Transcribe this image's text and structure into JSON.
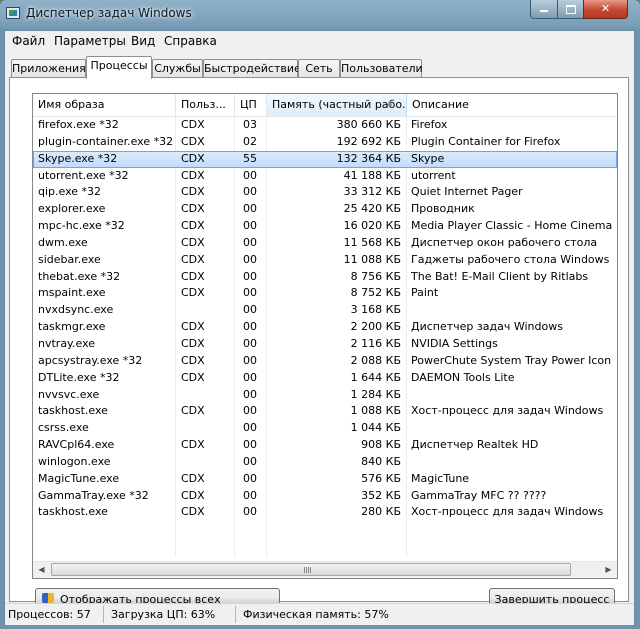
{
  "window": {
    "title": "Диспетчер задач Windows",
    "controls": [
      "minimize-icon",
      "maximize-icon",
      "close-icon"
    ]
  },
  "menu": [
    "Файл",
    "Параметры",
    "Вид",
    "Справка"
  ],
  "tabs": [
    {
      "label": "Приложения",
      "active": false
    },
    {
      "label": "Процессы",
      "active": true
    },
    {
      "label": "Службы",
      "active": false
    },
    {
      "label": "Быстродействие",
      "active": false
    },
    {
      "label": "Сеть",
      "active": false
    },
    {
      "label": "Пользователи",
      "active": false
    }
  ],
  "columns": [
    {
      "label": "Имя образа"
    },
    {
      "label": "Польз..."
    },
    {
      "label": "ЦП"
    },
    {
      "label": "Память (частный рабо...",
      "sorted": true
    },
    {
      "label": "Описание"
    }
  ],
  "processes": [
    {
      "name": "firefox.exe *32",
      "user": "CDX",
      "cpu": "03",
      "memory": "380 660 КБ",
      "description": "Firefox"
    },
    {
      "name": "plugin-container.exe *32",
      "user": "CDX",
      "cpu": "02",
      "memory": "192 692 КБ",
      "description": "Plugin Container for Firefox"
    },
    {
      "name": "Skype.exe *32",
      "user": "CDX",
      "cpu": "55",
      "memory": "132 364 КБ",
      "description": "Skype",
      "selected": true
    },
    {
      "name": "utorrent.exe *32",
      "user": "CDX",
      "cpu": "00",
      "memory": "41 188 КБ",
      "description": "utorrent"
    },
    {
      "name": "qip.exe *32",
      "user": "CDX",
      "cpu": "00",
      "memory": "33 312 КБ",
      "description": "Quiet Internet Pager"
    },
    {
      "name": "explorer.exe",
      "user": "CDX",
      "cpu": "00",
      "memory": "25 420 КБ",
      "description": "Проводник"
    },
    {
      "name": "mpc-hc.exe *32",
      "user": "CDX",
      "cpu": "00",
      "memory": "16 020 КБ",
      "description": "Media Player Classic - Home Cinema"
    },
    {
      "name": "dwm.exe",
      "user": "CDX",
      "cpu": "00",
      "memory": "11 568 КБ",
      "description": "Диспетчер окон рабочего стола"
    },
    {
      "name": "sidebar.exe",
      "user": "CDX",
      "cpu": "00",
      "memory": "11 088 КБ",
      "description": "Гаджеты рабочего стола Windows"
    },
    {
      "name": "thebat.exe *32",
      "user": "CDX",
      "cpu": "00",
      "memory": "8 756 КБ",
      "description": "The Bat! E-Mail Client by Ritlabs"
    },
    {
      "name": "mspaint.exe",
      "user": "CDX",
      "cpu": "00",
      "memory": "8 752 КБ",
      "description": "Paint"
    },
    {
      "name": "nvxdsync.exe",
      "user": "",
      "cpu": "00",
      "memory": "3 168 КБ",
      "description": ""
    },
    {
      "name": "taskmgr.exe",
      "user": "CDX",
      "cpu": "00",
      "memory": "2 200 КБ",
      "description": "Диспетчер задач Windows"
    },
    {
      "name": "nvtray.exe",
      "user": "CDX",
      "cpu": "00",
      "memory": "2 116 КБ",
      "description": "NVIDIA Settings"
    },
    {
      "name": "apcsystray.exe *32",
      "user": "CDX",
      "cpu": "00",
      "memory": "2 088 КБ",
      "description": "PowerChute System Tray Power Icon"
    },
    {
      "name": "DTLite.exe *32",
      "user": "CDX",
      "cpu": "00",
      "memory": "1 644 КБ",
      "description": "DAEMON Tools Lite"
    },
    {
      "name": "nvvsvc.exe",
      "user": "",
      "cpu": "00",
      "memory": "1 284 КБ",
      "description": ""
    },
    {
      "name": "taskhost.exe",
      "user": "CDX",
      "cpu": "00",
      "memory": "1 088 КБ",
      "description": "Хост-процесс для задач Windows"
    },
    {
      "name": "csrss.exe",
      "user": "",
      "cpu": "00",
      "memory": "1 044 КБ",
      "description": ""
    },
    {
      "name": "RAVCpl64.exe",
      "user": "CDX",
      "cpu": "00",
      "memory": "908 КБ",
      "description": "Диспетчер Realtek HD"
    },
    {
      "name": "winlogon.exe",
      "user": "",
      "cpu": "00",
      "memory": "840 КБ",
      "description": ""
    },
    {
      "name": "MagicTune.exe",
      "user": "CDX",
      "cpu": "00",
      "memory": "576 КБ",
      "description": "MagicTune"
    },
    {
      "name": "GammaTray.exe *32",
      "user": "CDX",
      "cpu": "00",
      "memory": "352 КБ",
      "description": "GammaTray MFC ?? ????"
    },
    {
      "name": "taskhost.exe",
      "user": "CDX",
      "cpu": "00",
      "memory": "280 КБ",
      "description": "Хост-процесс для задач Windows"
    }
  ],
  "buttons": {
    "show_all": "Отображать процессы всех пользователей",
    "end_process": "Завершить процесс"
  },
  "status": {
    "processes": "Процессов: 57",
    "cpu": "Загрузка ЦП: 63%",
    "memory": "Физическая память: 57%"
  }
}
